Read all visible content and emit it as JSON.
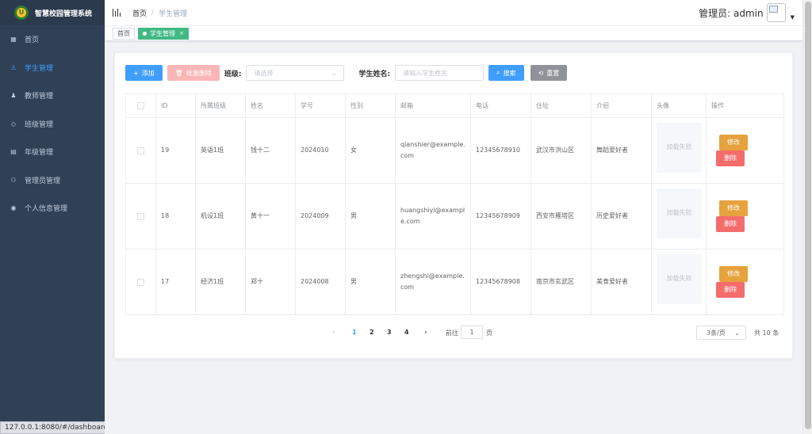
{
  "app": {
    "title": "智慧校园管理系统",
    "logo_letter": "U"
  },
  "sidebar": {
    "items": [
      {
        "label": "首页",
        "icon": "dashboard-icon",
        "active": false
      },
      {
        "label": "学生管理",
        "icon": "user-icon",
        "active": true
      },
      {
        "label": "教师管理",
        "icon": "people-icon",
        "active": false
      },
      {
        "label": "班级管理",
        "icon": "tag-icon",
        "active": false
      },
      {
        "label": "年级管理",
        "icon": "table-icon",
        "active": false
      },
      {
        "label": "管理员管理",
        "icon": "peoples-icon",
        "active": false
      },
      {
        "label": "个人信息管理",
        "icon": "user-circle-icon",
        "active": false
      }
    ]
  },
  "header": {
    "breadcrumb_home": "首页",
    "breadcrumb_sep": "/",
    "breadcrumb_current": "学生管理",
    "user_label": "管理员: admin"
  },
  "tags": {
    "home": "首页",
    "current": "学生管理",
    "close": "×"
  },
  "toolbar": {
    "add_label": "添加",
    "batch_delete_label": "批量删除",
    "class_label": "班级:",
    "class_placeholder": "请选择",
    "name_label": "学生姓名:",
    "name_placeholder": "请输入学生姓名",
    "search_label": "搜索",
    "reset_label": "重置"
  },
  "table": {
    "columns": [
      "",
      "ID",
      "所属班级",
      "姓名",
      "学号",
      "性别",
      "邮箱",
      "电话",
      "住址",
      "介绍",
      "头像",
      "操作"
    ],
    "rows": [
      {
        "id": "19",
        "class": "英语1班",
        "name": "钱十二",
        "student_no": "2024010",
        "gender": "女",
        "email": "qianshier@example.com",
        "phone": "12345678910",
        "address": "武汉市洪山区",
        "intro": "舞蹈爱好者",
        "avatar": "加载失败",
        "edit": "修改",
        "delete": "删除"
      },
      {
        "id": "18",
        "class": "机设1班",
        "name": "黄十一",
        "student_no": "2024009",
        "gender": "男",
        "email": "huangshiyi@example.com",
        "phone": "12345678909",
        "address": "西安市雁塔区",
        "intro": "历史爱好者",
        "avatar": "加载失败",
        "edit": "修改",
        "delete": "删除"
      },
      {
        "id": "17",
        "class": "经济1班",
        "name": "郑十",
        "student_no": "2024008",
        "gender": "男",
        "email": "zhengshi@example.com",
        "phone": "12345678908",
        "address": "南京市玄武区",
        "intro": "美食爱好者",
        "avatar": "加载失败",
        "edit": "修改",
        "delete": "删除"
      }
    ]
  },
  "pagination": {
    "prev": "‹",
    "next": "›",
    "pages": [
      "1",
      "2",
      "3",
      "4"
    ],
    "current_page": "1",
    "goto_label": "前往",
    "goto_value": "1",
    "page_unit": "页",
    "page_size": "3条/页",
    "total": "共 10 条"
  },
  "status_url": "127.0.0.1:8080/#/dashboard",
  "colors": {
    "sidebar_bg": "#304156",
    "primary": "#409eff",
    "tag_active": "#42b983",
    "warning": "#e6a23c",
    "danger": "#f56c6c"
  }
}
